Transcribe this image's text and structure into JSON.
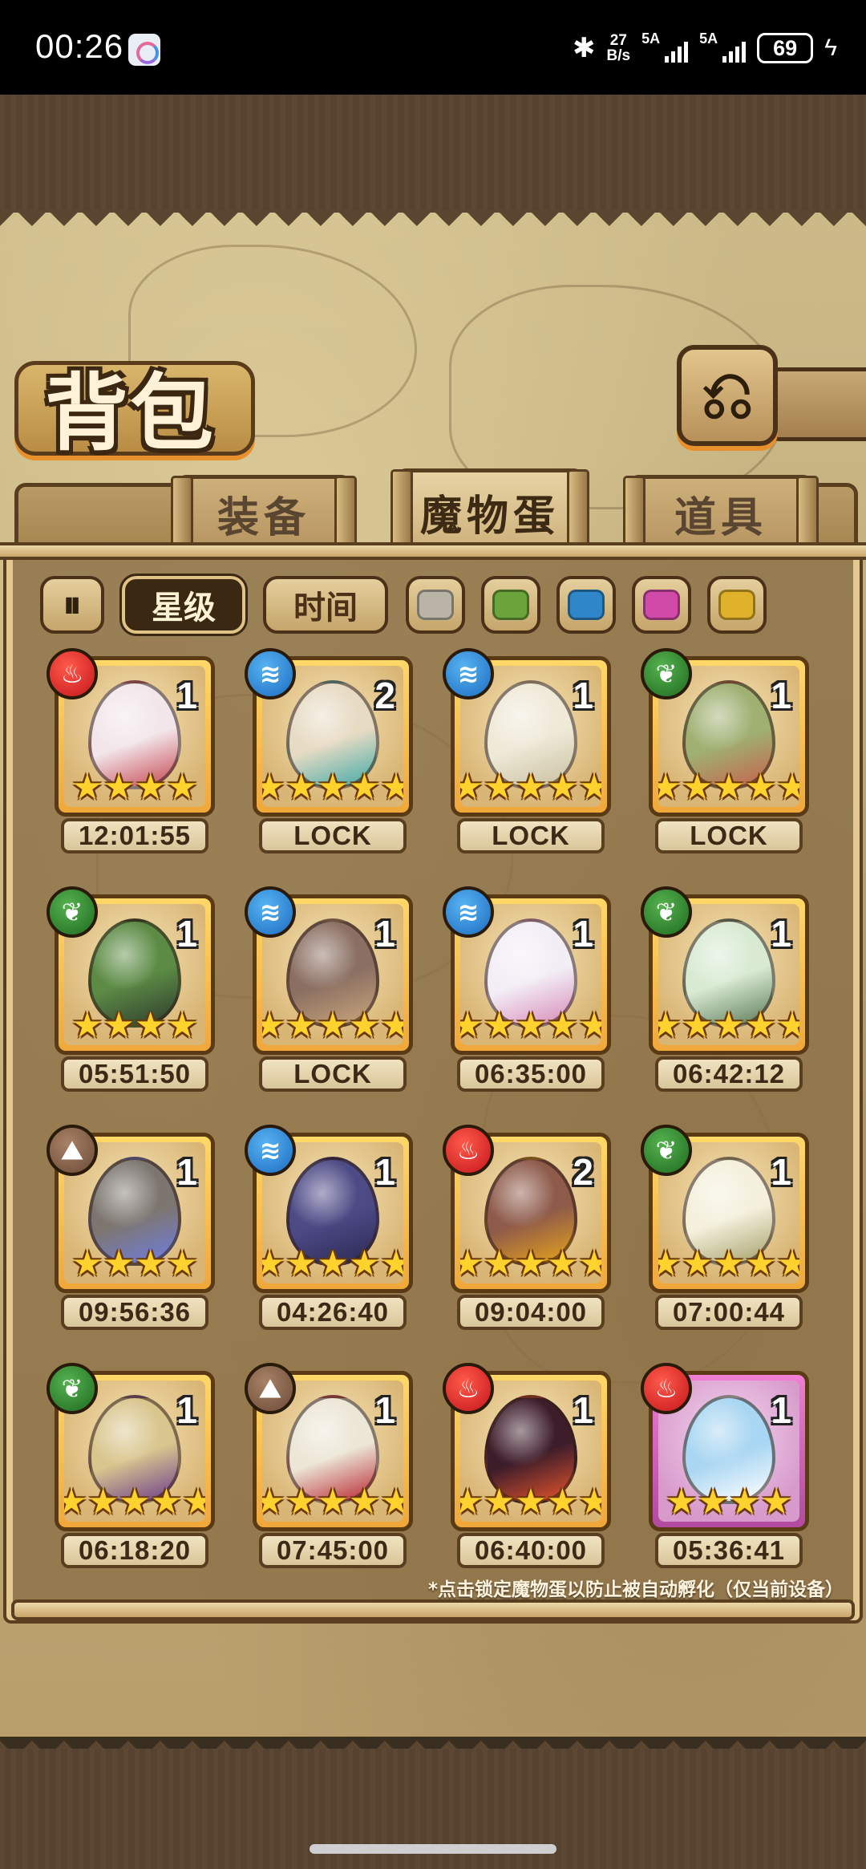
{
  "status_bar": {
    "time": "00:26",
    "speed_value": "27",
    "speed_unit": "B/s",
    "sim1": "5A",
    "sim2": "5A",
    "battery": "69"
  },
  "header": {
    "title": "背包",
    "back_icon": "⎌"
  },
  "tabs": [
    {
      "label": "装备",
      "active": false
    },
    {
      "label": "魔物蛋",
      "active": true
    },
    {
      "label": "道具",
      "active": false
    }
  ],
  "filters": {
    "sort_icon": "sort-toggle-icon",
    "star_label": "星级",
    "time_label": "时间",
    "active": "星级",
    "colors": [
      "#b9b4a6",
      "#6aa43a",
      "#2f86c8",
      "#d24aa8",
      "#e0b12a"
    ]
  },
  "eggs": [
    {
      "element": "fire",
      "count": "1",
      "stars": 4,
      "timer": "12:01:55",
      "color": "#f2e6ea",
      "accent": "#c5464f",
      "frame": "gold"
    },
    {
      "element": "water",
      "count": "2",
      "stars": 5,
      "timer": "LOCK",
      "color": "#e7dbc4",
      "accent": "#3fa9a7",
      "frame": "gold"
    },
    {
      "element": "water",
      "count": "1",
      "stars": 5,
      "timer": "LOCK",
      "color": "#efe9d8",
      "accent": "#c9c0a0",
      "frame": "gold"
    },
    {
      "element": "grass",
      "count": "1",
      "stars": 5,
      "timer": "LOCK",
      "color": "#9fb072",
      "accent": "#c7634c",
      "frame": "gold"
    },
    {
      "element": "grass",
      "count": "1",
      "stars": 4,
      "timer": "05:51:50",
      "color": "#5c8b45",
      "accent": "#2f3b2e",
      "frame": "gold"
    },
    {
      "element": "water",
      "count": "1",
      "stars": 5,
      "timer": "LOCK",
      "color": "#8b6f62",
      "accent": "#c9a77b",
      "frame": "gold"
    },
    {
      "element": "water",
      "count": "1",
      "stars": 5,
      "timer": "06:35:00",
      "color": "#f3eef6",
      "accent": "#d78ab8",
      "frame": "gold"
    },
    {
      "element": "grass",
      "count": "1",
      "stars": 5,
      "timer": "06:42:12",
      "color": "#d8ead2",
      "accent": "#5c7b58",
      "frame": "gold"
    },
    {
      "element": "earth",
      "count": "1",
      "stars": 4,
      "timer": "09:56:36",
      "color": "#7d7670",
      "accent": "#6e7de2",
      "frame": "gold"
    },
    {
      "element": "water",
      "count": "1",
      "stars": 5,
      "timer": "04:26:40",
      "color": "#4d4a86",
      "accent": "#2c2a55",
      "frame": "gold"
    },
    {
      "element": "fire",
      "count": "2",
      "stars": 5,
      "timer": "09:04:00",
      "color": "#8e5a4a",
      "accent": "#e7a31b",
      "frame": "gold"
    },
    {
      "element": "grass",
      "count": "1",
      "stars": 5,
      "timer": "07:00:44",
      "color": "#f4f0dc",
      "accent": "#a5a06a",
      "frame": "gold"
    },
    {
      "element": "grass",
      "count": "1",
      "stars": 5,
      "timer": "06:18:20",
      "color": "#d9c68e",
      "accent": "#6b3c8c",
      "frame": "gold"
    },
    {
      "element": "earth",
      "count": "1",
      "stars": 5,
      "timer": "07:45:00",
      "color": "#ece6d6",
      "accent": "#b82530",
      "frame": "gold"
    },
    {
      "element": "fire",
      "count": "1",
      "stars": 5,
      "timer": "06:40:00",
      "color": "#3d1d2a",
      "accent": "#e9542e",
      "frame": "gold"
    },
    {
      "element": "fire",
      "count": "1",
      "stars": 4,
      "timer": "05:36:41",
      "color": "#a9d6f2",
      "accent": "#ffffff",
      "frame": "purple"
    }
  ],
  "note": "*点击锁定魔物蛋以防止被自动孵化（仅当前设备）"
}
